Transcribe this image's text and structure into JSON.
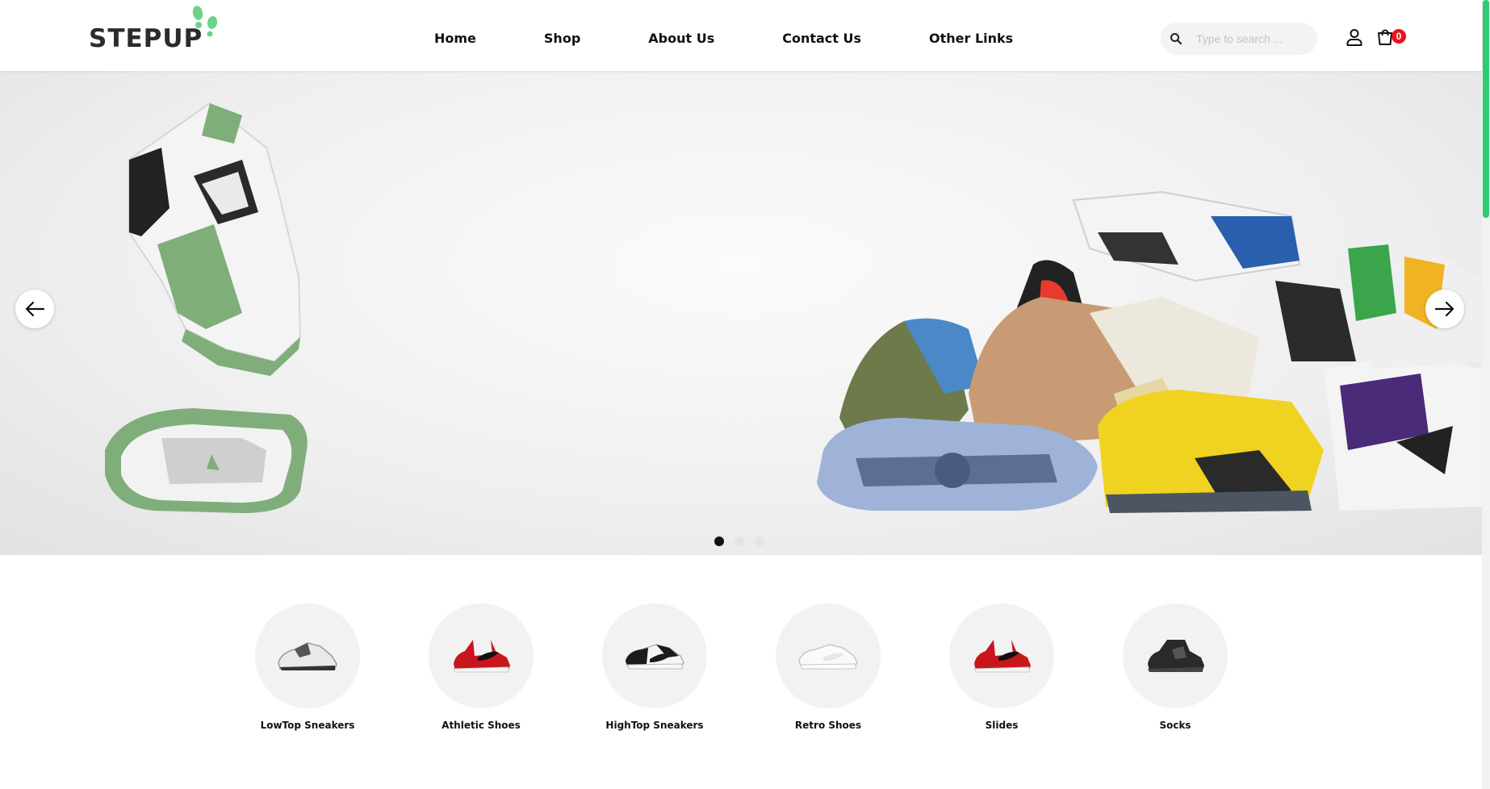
{
  "brand": {
    "name": "STEPUP",
    "accent_color": "#6cd389"
  },
  "nav": {
    "items": [
      {
        "label": "Home"
      },
      {
        "label": "Shop"
      },
      {
        "label": "About Us"
      },
      {
        "label": "Contact Us"
      },
      {
        "label": "Other Links"
      }
    ]
  },
  "search": {
    "placeholder": "Type to search ...",
    "value": "",
    "icon": "search-icon"
  },
  "header_icons": {
    "user": "user-icon",
    "cart": "shopping-bag-icon"
  },
  "cart": {
    "count": "0",
    "badge_color": "#e8141a"
  },
  "hero": {
    "prev_icon": "arrow-left-icon",
    "next_icon": "arrow-right-icon",
    "slides": 3,
    "active_slide": 1
  },
  "categories": [
    {
      "label": "LowTop Sneakers"
    },
    {
      "label": "Athletic Shoes"
    },
    {
      "label": "HighTop Sneakers"
    },
    {
      "label": "Retro Shoes"
    },
    {
      "label": "Slides"
    },
    {
      "label": "Socks"
    }
  ],
  "scrollbar_color": "#2ecc71"
}
